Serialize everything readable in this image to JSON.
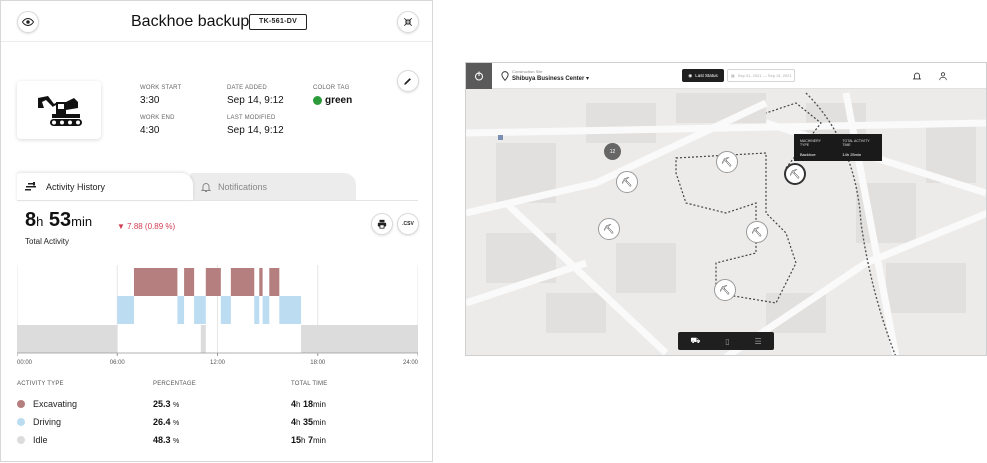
{
  "panel": {
    "title": "Backhoe backup",
    "machine_tag": "TK-561-DV",
    "meta": {
      "work_start_label": "WORK START",
      "work_start": "3:30",
      "work_end_label": "WORK END",
      "work_end": "4:30",
      "date_added_label": "DATE ADDED",
      "date_added": "Sep 14, 9:12",
      "last_modified_label": "LAST MODIFIED",
      "last_modified": "Sep 14, 9:12",
      "color_tag_label": "COLOR TAG",
      "color_tag": "green",
      "color_tag_hex": "#2b9b3a"
    },
    "tabs": {
      "activity": "Activity History",
      "notifications": "Notifications"
    },
    "total": {
      "hours": "8",
      "hours_unit": "h",
      "minutes": "53",
      "minutes_unit": "min",
      "delta": "▼ 7.88 (0.89 %)",
      "label": "Total Activity",
      "csv": ".CSV"
    },
    "table": {
      "head_type": "ACTIVITY TYPE",
      "head_pct": "PERCENTAGE",
      "head_time": "TOTAL TIME",
      "rows": [
        {
          "type": "Excavating",
          "pct": "25.3",
          "pct_unit": "%",
          "h": "4",
          "m": "18",
          "color": "#b57f7f"
        },
        {
          "type": "Driving",
          "pct": "26.4",
          "pct_unit": "%",
          "h": "4",
          "m": "35",
          "color": "#bcdcf2"
        },
        {
          "type": "Idle",
          "pct": "48.3",
          "pct_unit": "%",
          "h": "15",
          "m": "7",
          "color": "#dcdcdc"
        }
      ],
      "h_unit": "h",
      "m_unit": "min"
    }
  },
  "chart_data": {
    "type": "bar",
    "title": "",
    "x_ticks": [
      "00:00",
      "06:00",
      "12:00",
      "18:00",
      "24:00"
    ],
    "xlim": [
      0,
      24
    ],
    "series": [
      {
        "name": "Excavating",
        "color": "#b57f7f",
        "intervals": [
          [
            7.0,
            9.6
          ],
          [
            10.0,
            10.6
          ],
          [
            11.3,
            12.2
          ],
          [
            12.8,
            14.2
          ],
          [
            14.5,
            14.7
          ],
          [
            15.1,
            15.7
          ]
        ]
      },
      {
        "name": "Driving",
        "color": "#bcdcf2",
        "intervals": [
          [
            6.0,
            7.0
          ],
          [
            9.6,
            10.0
          ],
          [
            10.6,
            11.3
          ],
          [
            12.2,
            12.8
          ],
          [
            14.2,
            14.5
          ],
          [
            14.7,
            15.1
          ],
          [
            15.7,
            17.0
          ]
        ]
      },
      {
        "name": "Idle",
        "color": "#dcdcdc",
        "intervals": [
          [
            0.0,
            6.0
          ],
          [
            11.0,
            11.3
          ],
          [
            17.0,
            24.0
          ]
        ]
      }
    ]
  },
  "map": {
    "site_label": "Construction Site",
    "site_name": "Shibuya Business Center",
    "last_status": "Last Status",
    "date_range": "Sep 01, 2021 — Sep 14, 2021",
    "cluster_count": "12",
    "tooltip": {
      "type_label": "MACHINERY TYPE",
      "type_value": "Backhoe",
      "time_label": "TOTAL ACTIVITY TIME",
      "time_value": "14h 25min"
    }
  }
}
